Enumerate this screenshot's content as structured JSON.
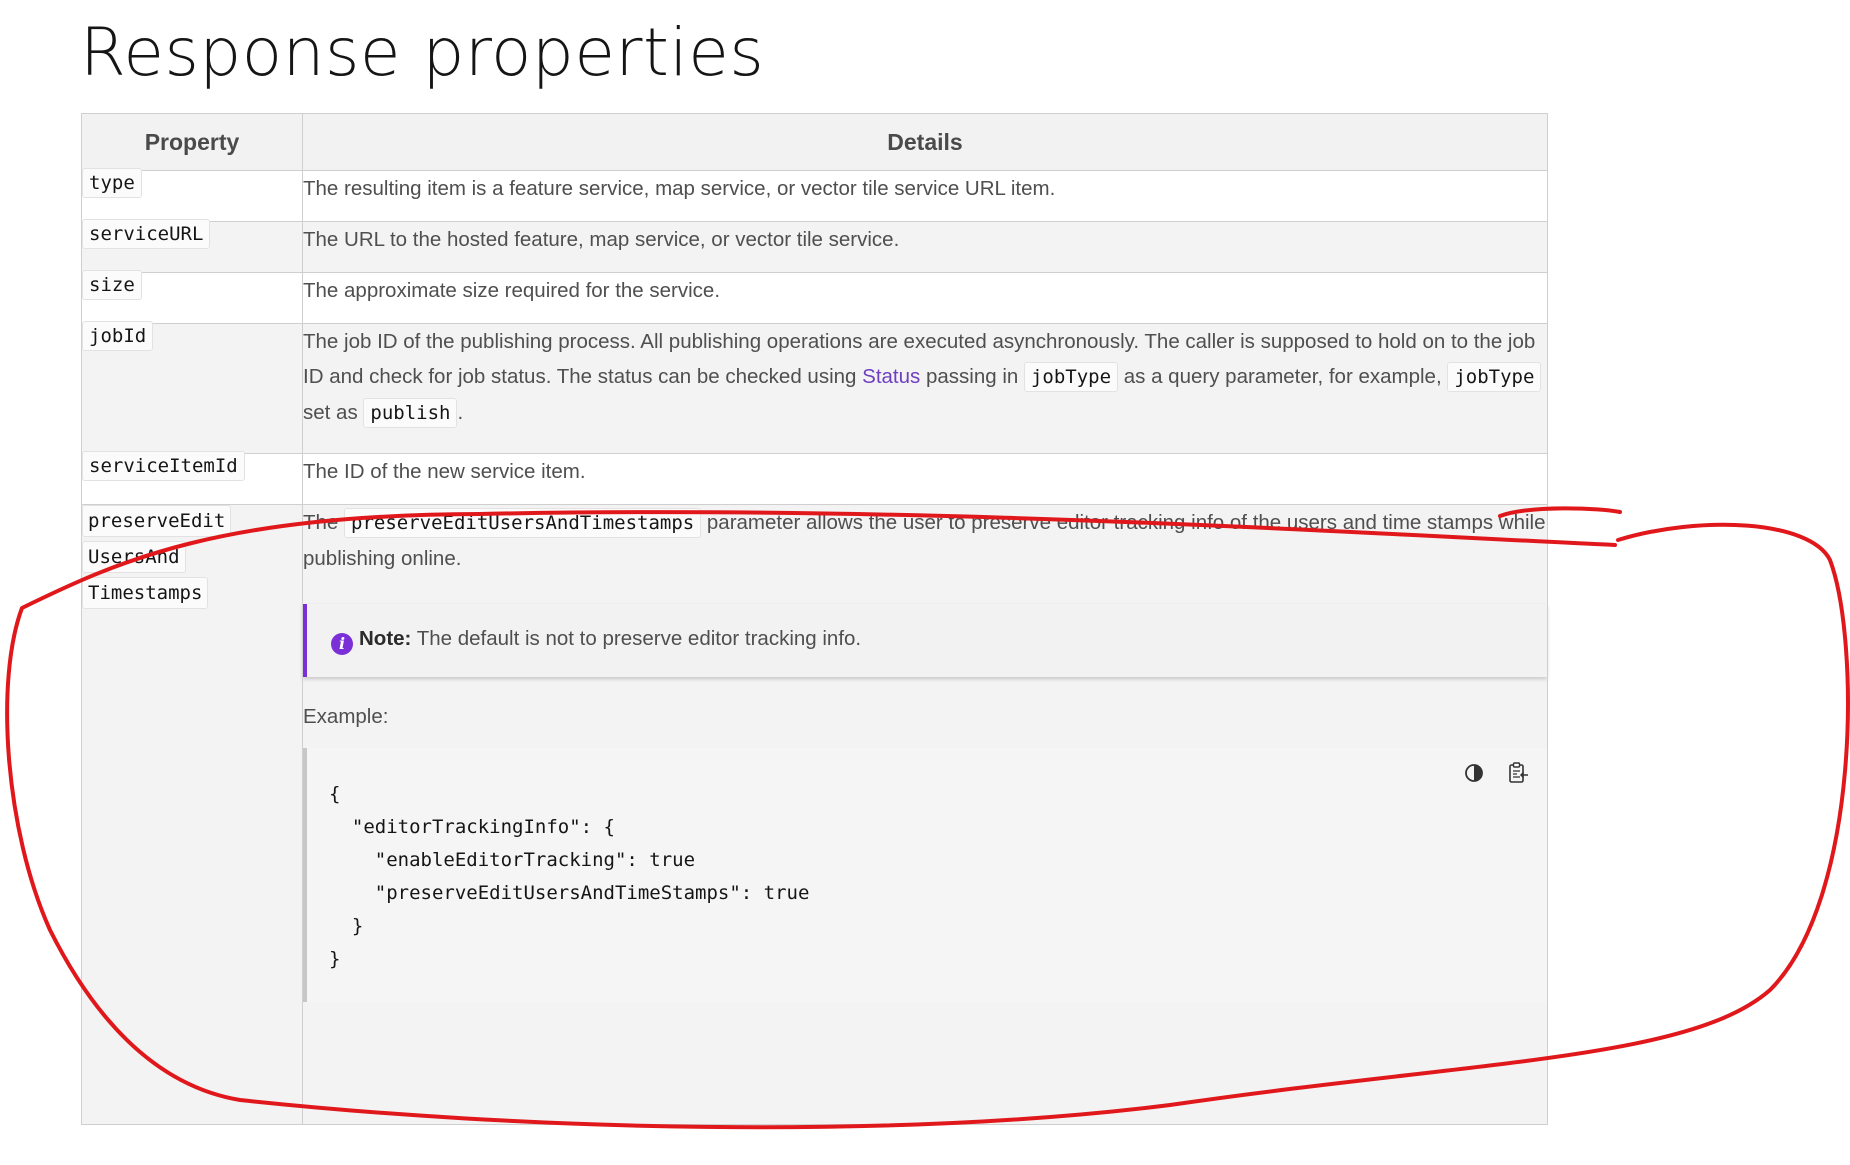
{
  "page": {
    "title": "Response properties"
  },
  "table": {
    "headers": {
      "property": "Property",
      "details": "Details"
    },
    "rows": [
      {
        "property": "type",
        "details": "The resulting item is a feature service, map service, or vector tile service URL item."
      },
      {
        "property": "serviceURL",
        "details": "The URL to the hosted feature, map service, or vector tile service."
      },
      {
        "property": "size",
        "details": "The approximate size required for the service."
      },
      {
        "property": "jobId",
        "details": {
          "part1": "The job ID of the publishing process. All publishing operations are executed asynchronously. The caller is supposed to hold on to the job ID and check for job status. The status can be checked using ",
          "link": "Status",
          "part2": " passing in ",
          "code1": "jobType",
          "part3": " as a query parameter, for example, ",
          "code2": "jobType",
          "part4": " set as ",
          "code3": "publish",
          "part5": "."
        }
      },
      {
        "property": "serviceItemId",
        "details": "The ID of the new service item."
      },
      {
        "property_lines": [
          "preserveEdit",
          "UsersAnd",
          "Timestamps"
        ],
        "details": {
          "intro_prefix": "The ",
          "intro_code": "preserveEditUsersAndTimestamps",
          "intro_suffix": " parameter allows the user to preserve editor tracking info of the users and time stamps while publishing online.",
          "note_label": "Note:",
          "note_text": " The default is not to preserve editor tracking info.",
          "example_label": "Example:",
          "code_sample": "{\n  \"editorTrackingInfo\": {\n    \"enableEditorTracking\": true\n    \"preserveEditUsersAndTimeStamps\": true\n  }\n}"
        }
      }
    ]
  },
  "icons": {
    "info": "info-icon",
    "theme_toggle": "contrast-icon",
    "copy": "copy-clipboard-icon"
  },
  "colors": {
    "annotation": "#e0181b",
    "note_accent": "#7b2fd6",
    "link": "#6e3fc0"
  }
}
